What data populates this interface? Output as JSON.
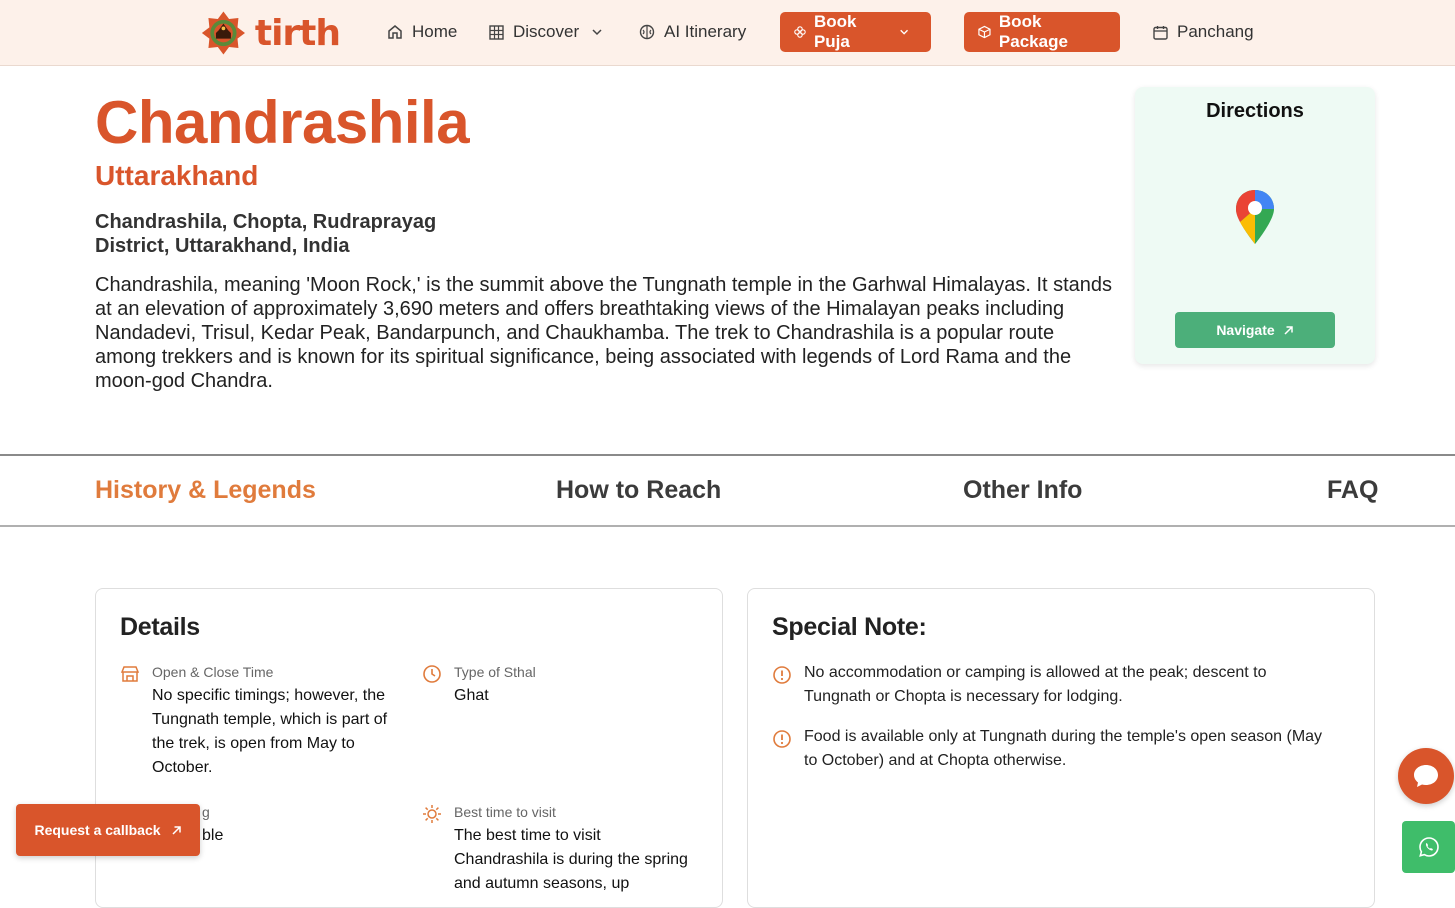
{
  "brand": {
    "name": "tirth",
    "color": "#d9552b"
  },
  "nav": {
    "home": "Home",
    "discover": "Discover",
    "ai_itinerary": "AI Itinerary",
    "book_puja": "Book Puja",
    "book_package": "Book Package",
    "panchang": "Panchang"
  },
  "hero": {
    "title": "Chandrashila",
    "state": "Uttarakhand",
    "address": "Chandrashila, Chopta, Rudraprayag District, Uttarakhand, India",
    "description": "Chandrashila, meaning 'Moon Rock,' is the summit above the Tungnath temple in the Garhwal Himalayas. It stands at an elevation of approximately 3,690 meters and offers breathtaking views of the Himalayan peaks including Nandadevi, Trisul, Kedar Peak, Bandarpunch, and Chaukhamba. The trek to Chandrashila is a popular route among trekkers and is known for its spiritual significance, being associated with legends of Lord Rama and the moon-god Chandra."
  },
  "directions": {
    "title": "Directions",
    "navigate_label": "Navigate",
    "accent": "#4caf7a"
  },
  "tabs": [
    {
      "label": "History & Legends",
      "active": true
    },
    {
      "label": "How to Reach",
      "active": false
    },
    {
      "label": "Other Info",
      "active": false
    },
    {
      "label": "FAQ",
      "active": false
    }
  ],
  "details": {
    "title": "Details",
    "items": [
      {
        "label": "Open & Close Time",
        "value": "No specific timings; however, the Tungnath temple, which is part of the trek, is open from May to October.",
        "icon": "temple-icon"
      },
      {
        "label": "Type of Sthal",
        "value": "Ghat",
        "icon": "clock-icon"
      },
      {
        "label": "g",
        "value": "ble",
        "icon": "info-icon"
      },
      {
        "label": "Best time to visit",
        "value": "The best time to visit Chandrashila is during the spring and autumn seasons, up",
        "icon": "sun-icon"
      }
    ]
  },
  "special_note": {
    "title": "Special Note:",
    "items": [
      "No accommodation or camping is allowed at the peak; descent to Tungnath or Chopta is necessary for lodging.",
      "Food is available only at Tungnath during the temple's open season (May to October) and at Chopta otherwise."
    ]
  },
  "floating": {
    "callback_label": "Request a callback",
    "chat_color": "#d9552b",
    "whatsapp_color": "#3fbd6a"
  }
}
